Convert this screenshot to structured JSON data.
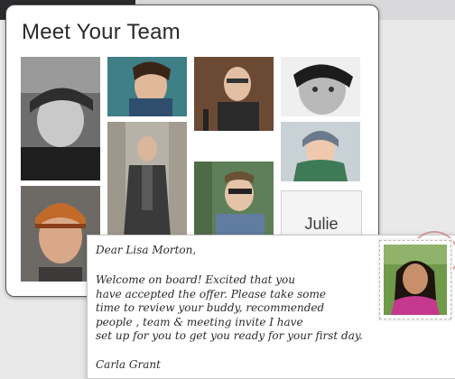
{
  "team_card": {
    "title": "Meet Your Team",
    "placeholder_tile": {
      "first_name": "Julie",
      "last_name": ""
    }
  },
  "letter": {
    "greeting": "Dear Lisa Morton,",
    "body_lines": [
      "Welcome on board! Excited that you",
      "have accepted the offer. Please take some",
      "time to review your buddy, recommended",
      "people , team & meeting invite I have",
      "set up for you to get you ready for your first day."
    ],
    "signature": "Carla Grant"
  },
  "colors": {
    "card_border": "#5a5a5a",
    "title_text": "#2a2a2a",
    "letter_text": "#2b2b2b",
    "postmark": "#be5a5a"
  }
}
